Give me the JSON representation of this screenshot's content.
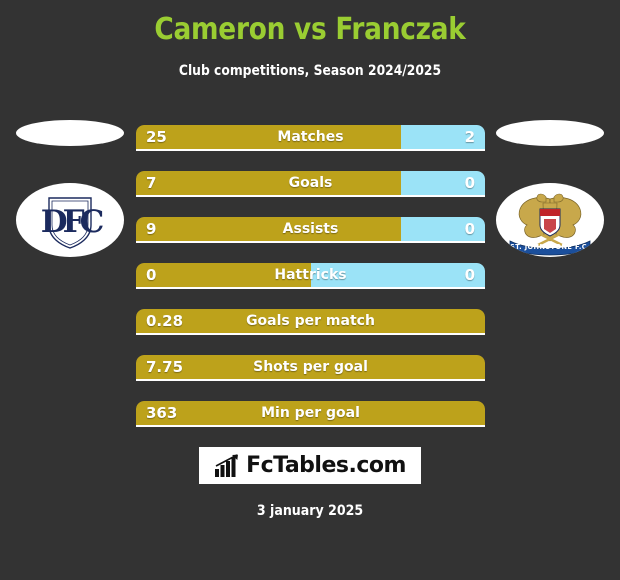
{
  "header": {
    "title": "Cameron vs Franczak",
    "subtitle": "Club competitions, Season 2024/2025",
    "title_color": "#9ACD32"
  },
  "crests": {
    "home": {
      "name": "Dundee FC",
      "monogram": "DFC",
      "primary_color": "#1B2A5E",
      "background_color": "#FFFFFF"
    },
    "away": {
      "name": "St Johnstone FC",
      "banner_text": "ST. JOHNSTONE F.C.",
      "primary_color": "#1B4F9C",
      "accent_color": "#C8A84B",
      "shield_color": "#C0242A",
      "background_color": "#FFFFFF"
    }
  },
  "colors": {
    "background": "#333333",
    "home_bar": "#BDA21B",
    "away_bar": "#9BE3F7",
    "text": "#FFFFFF"
  },
  "chart_data": {
    "type": "bar",
    "title": "Cameron vs Franczak",
    "subtitle": "Club competitions, Season 2024/2025",
    "orientation": "horizontal-diverging",
    "legend_position": "none",
    "grid": false,
    "series": [
      {
        "name": "Cameron",
        "color": "#BDA21B",
        "values": [
          25,
          7,
          9,
          0,
          0.28,
          7.75,
          363
        ]
      },
      {
        "name": "Franczak",
        "color": "#9BE3F7",
        "values": [
          2,
          0,
          0,
          0,
          null,
          null,
          null
        ]
      }
    ],
    "categories": [
      "Matches",
      "Goals",
      "Assists",
      "Hattricks",
      "Goals per match",
      "Shots per goal",
      "Min per goal"
    ],
    "rows": [
      {
        "label": "Matches",
        "home": "25",
        "away": "2",
        "home_pct": 76,
        "has_away": true
      },
      {
        "label": "Goals",
        "home": "7",
        "away": "0",
        "home_pct": 76,
        "has_away": true
      },
      {
        "label": "Assists",
        "home": "9",
        "away": "0",
        "home_pct": 76,
        "has_away": true
      },
      {
        "label": "Hattricks",
        "home": "0",
        "away": "0",
        "home_pct": 50,
        "has_away": true
      },
      {
        "label": "Goals per match",
        "home": "0.28",
        "away": "",
        "home_pct": 100,
        "has_away": false
      },
      {
        "label": "Shots per goal",
        "home": "7.75",
        "away": "",
        "home_pct": 100,
        "has_away": false
      },
      {
        "label": "Min per goal",
        "home": "363",
        "away": "",
        "home_pct": 100,
        "has_away": false
      }
    ]
  },
  "footer": {
    "brand": "FcTables.com",
    "brand_icon": "bar-chart-growth-icon",
    "date": "3 january 2025"
  }
}
